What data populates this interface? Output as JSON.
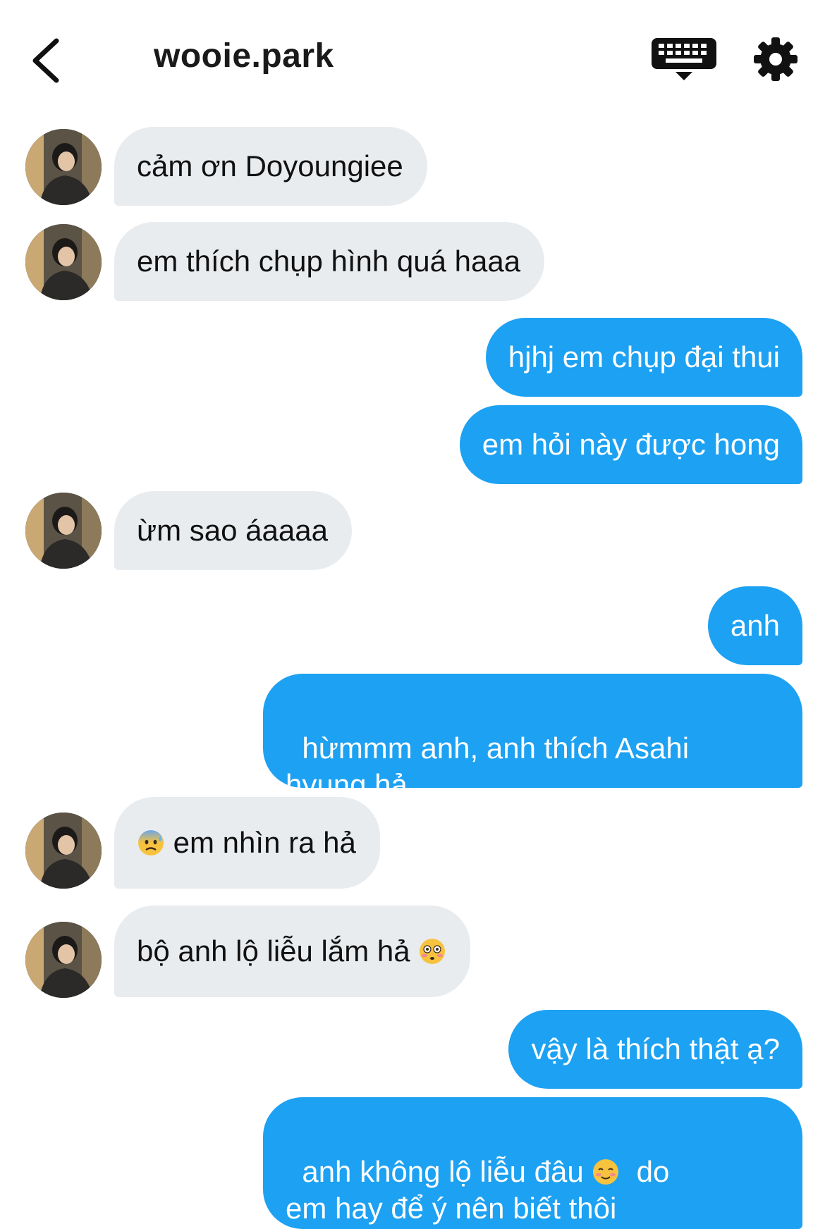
{
  "header": {
    "title": "wooie.park"
  },
  "messages": [
    {
      "side": "in",
      "text": "cảm ơn Doyoungiee"
    },
    {
      "side": "in",
      "text": "em thích chụp hình quá haaa"
    },
    {
      "side": "out",
      "text": "hjhj em chụp đại thui"
    },
    {
      "side": "out",
      "text": "em hỏi này được hong"
    },
    {
      "side": "in",
      "text": "ừm sao áaaaa"
    },
    {
      "side": "out",
      "text": "anh"
    },
    {
      "side": "out",
      "text": "hừmmm anh, anh thích Asahi hyung hả"
    },
    {
      "side": "in",
      "emoji": "anxious-sweat-emoji",
      "text": " em nhìn ra hả"
    },
    {
      "side": "in",
      "text": "bộ anh lộ liễu lắm hả ",
      "emoji": "flushed-emoji"
    },
    {
      "side": "out",
      "text": "vậy là thích thật ạ?"
    },
    {
      "side": "out",
      "text_a": "anh không lộ liễu đâu ",
      "emoji": "smiling-blush-emoji",
      "text_b": "  do em hay để ý nên biết thôi"
    }
  ],
  "colors": {
    "outgoing_bubble": "#1da1f2",
    "incoming_bubble": "#e9ecef",
    "text": "#111111"
  },
  "icons": [
    "back-arrow-icon",
    "keyboard-icon",
    "gear-icon",
    "avatar"
  ]
}
